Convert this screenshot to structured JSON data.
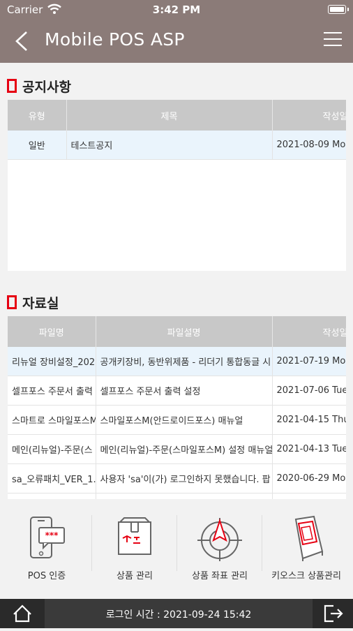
{
  "status": {
    "carrier": "Carrier",
    "time": "3:42 PM"
  },
  "header": {
    "title": "Mobile POS ASP"
  },
  "notice": {
    "title": "공지사항",
    "columns": [
      "유형",
      "제목",
      "작성일"
    ],
    "rows": [
      {
        "type": "일반",
        "subject": "테스트공지",
        "date": "2021-08-09 Mo"
      }
    ]
  },
  "archive": {
    "title": "자료실",
    "columns": [
      "파일명",
      "파일설명",
      "작성일"
    ],
    "rows": [
      {
        "file": "리뉴얼 장비설정_202",
        "desc": "공개키장비, 동반위제품 - 리더기 통합동글 시",
        "date": "2021-07-19 Mo"
      },
      {
        "file": "셀프포스 주문서 출력",
        "desc": "셀프포스 주문서 출력 설정",
        "date": "2021-07-06 Tue"
      },
      {
        "file": "스마트로 스마일포스M",
        "desc": "스마일포스M(안드로이드포스) 매뉴얼",
        "date": "2021-04-15 Thu"
      },
      {
        "file": "메인(리뉴얼)-주문(스",
        "desc": "메인(리뉴얼)-주문(스마일포스M) 설정 매뉴얼",
        "date": "2021-04-13 Tue"
      },
      {
        "file": "sa_오류패치_VER_1.",
        "desc": "사용자 'sa'이(가) 로그인하지 못했습니다. 팝",
        "date": "2020-06-29 Mo"
      },
      {
        "file": "",
        "desc": "",
        "date": ""
      }
    ]
  },
  "bottom_menu": [
    {
      "label": "POS 인증",
      "icon": "phone-lock-icon"
    },
    {
      "label": "상품 관리",
      "icon": "box-icon"
    },
    {
      "label": "상품 좌표 관리",
      "icon": "target-icon"
    },
    {
      "label": "키오스크 상품관리",
      "icon": "kiosk-icon"
    }
  ],
  "footer": {
    "login_time": "로그인 시간 : 2021-09-24 15:42"
  },
  "colors": {
    "header": "#8b7b78",
    "accent": "#e60012",
    "table_header": "#c8c8c8",
    "footer": "#3a3a3a"
  }
}
